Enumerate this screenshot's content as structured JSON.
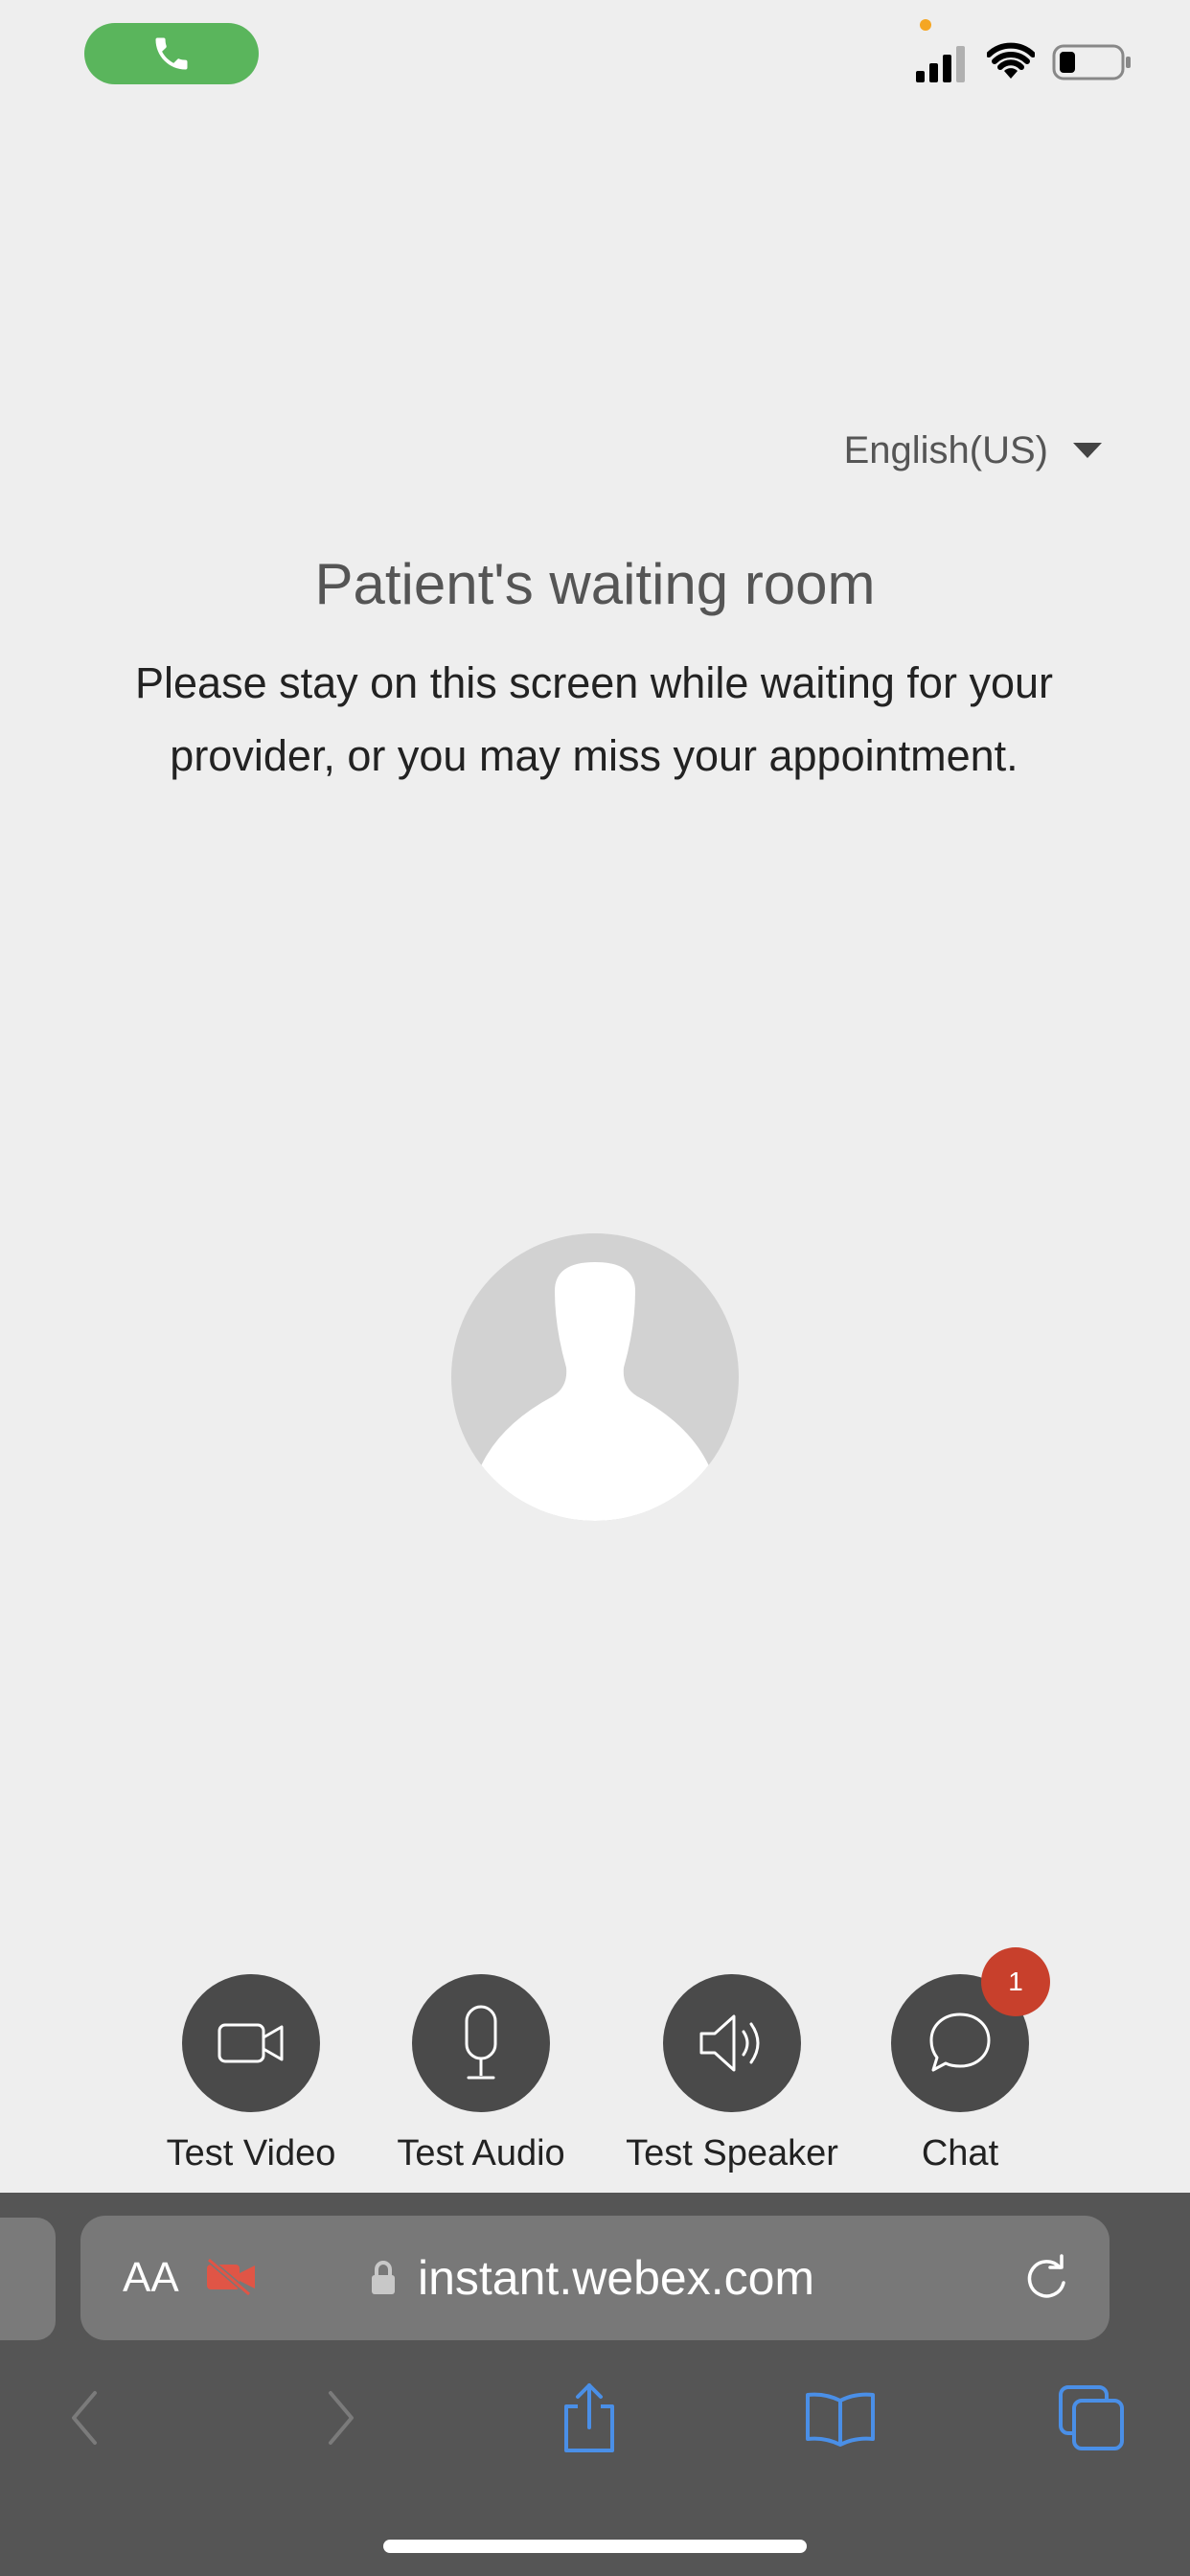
{
  "status_bar": {
    "call_icon": "phone-icon",
    "signal_icon": "cellular-signal-icon",
    "wifi_icon": "wifi-icon",
    "battery_icon": "battery-icon",
    "call_pill_color": "#5ab55c",
    "privacy_dot_color": "#f5a623"
  },
  "language": {
    "selected": "English(US)",
    "icon": "chevron-down-icon"
  },
  "waiting_room": {
    "title": "Patient's waiting room",
    "message": "Please stay on this screen while waiting for your provider, or you may miss your appointment."
  },
  "avatar": {
    "icon": "person-placeholder-icon"
  },
  "controls": {
    "test_video": {
      "label": "Test Video",
      "icon": "video-camera-icon"
    },
    "test_audio": {
      "label": "Test Audio",
      "icon": "microphone-icon"
    },
    "test_speaker": {
      "label": "Test Speaker",
      "icon": "speaker-icon"
    },
    "chat": {
      "label": "Chat",
      "icon": "chat-bubble-icon",
      "badge": "1",
      "badge_color": "#c8402c"
    }
  },
  "browser": {
    "text_size_label": "AA",
    "url": "instant.webex.com",
    "camera_off_icon": "video-off-icon",
    "lock_icon": "lock-icon",
    "reload_icon": "reload-icon",
    "toolbar": [
      "back-icon",
      "forward-icon",
      "share-icon",
      "bookmarks-icon",
      "tabs-icon"
    ],
    "accent_color": "#4a8fe7"
  }
}
